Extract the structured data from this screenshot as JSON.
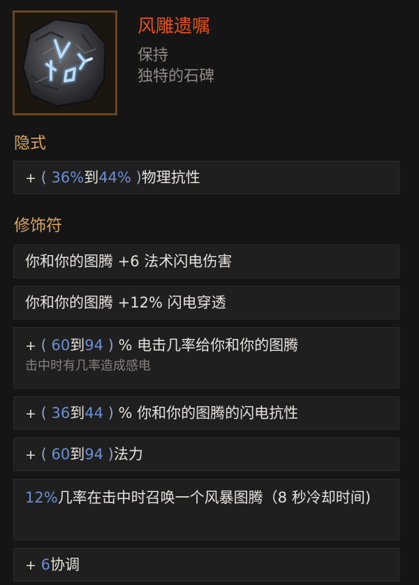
{
  "item": {
    "name": "风雕遗嘱",
    "subtitle_1": "保持",
    "subtitle_2": "独特的石碑",
    "icon": "rune-stone-icon",
    "colors": {
      "name": "#e0511e",
      "heading": "#d8a45a",
      "value": "#6b8fd6",
      "note": "#86817b",
      "frame": "#6a4622"
    }
  },
  "implicit": {
    "heading": "隐式",
    "rows": [
      {
        "prefix": "+",
        "open": "(",
        "min": "36%",
        "to": "到",
        "max": "44%",
        "close": ")",
        "suffix": "物理抗性"
      }
    ]
  },
  "modifiers": {
    "heading": "修饰符",
    "rows": [
      {
        "text": "你和你的图腾 +6 法术闪电伤害"
      },
      {
        "text": "你和你的图腾 +12% 闪电穿透"
      },
      {
        "prefix": "+",
        "open": "(",
        "min": "60",
        "to": "到",
        "max": "94",
        "close": ")",
        "suffix": "% 电击几率给你和你的图腾",
        "note": "击中时有几率造成感电"
      },
      {
        "prefix": "+",
        "open": "(",
        "min": "36",
        "to": "到",
        "max": "44",
        "close": ")",
        "suffix": "% 你和你的图腾的闪电抗性"
      },
      {
        "prefix": "+",
        "open": "(",
        "min": "60",
        "to": "到",
        "max": "94",
        "close": ")",
        "suffix": "法力"
      },
      {
        "value": "12%",
        "text": "几率在击中时召唤一个风暴图腾（8 秒冷却时间)"
      },
      {
        "prefix": "+",
        "value": "6",
        "suffix": "协调"
      }
    ]
  }
}
